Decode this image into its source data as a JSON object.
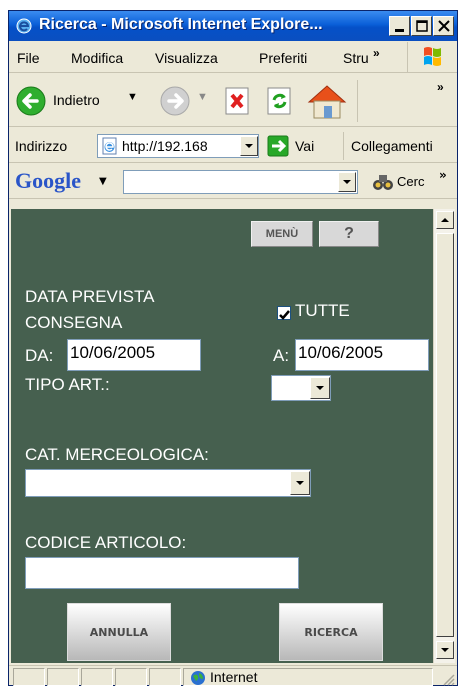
{
  "window": {
    "title": "Ricerca - Microsoft Internet Explore...",
    "accent_color": "#0a5fd8",
    "content_bg": "#46604f"
  },
  "menu": {
    "items": [
      "File",
      "Modifica",
      "Visualizza",
      "Preferiti",
      "Stru"
    ],
    "more": "»"
  },
  "toolbar": {
    "back_label": "Indietro",
    "more": "»"
  },
  "address": {
    "label": "Indirizzo",
    "value": "http://192.168",
    "go_label": "Vai",
    "links_label": "Collegamenti"
  },
  "google": {
    "logo": "Google",
    "search_value": "",
    "search_label": "Cerc",
    "more": "»"
  },
  "form": {
    "menu_button": "MENÙ",
    "help_button": "?",
    "date_label_line1": "DATA PREVISTA",
    "date_label_line2": "CONSEGNA",
    "all_label": "TUTTE",
    "all_checked": true,
    "from_label": "DA:",
    "from_value": "10/06/2005",
    "to_label": "A:",
    "to_value": "10/06/2005",
    "type_label": "TIPO ART.:",
    "type_value": "",
    "category_label": "CAT. MERCEOLOGICA:",
    "category_value": "",
    "code_label": "CODICE ARTICOLO:",
    "code_value": "",
    "cancel_button": "ANNULLA",
    "search_button": "RICERCA"
  },
  "status": {
    "zone_label": "Internet"
  },
  "icons": [
    "ie-icon",
    "minimize-icon",
    "maximize-icon",
    "close-icon",
    "windows-logo-icon",
    "back-arrow-icon",
    "forward-arrow-icon",
    "stop-icon",
    "refresh-icon",
    "home-icon",
    "page-icon",
    "go-arrow-icon",
    "binoculars-icon",
    "globe-icon",
    "resize-grip-icon"
  ]
}
